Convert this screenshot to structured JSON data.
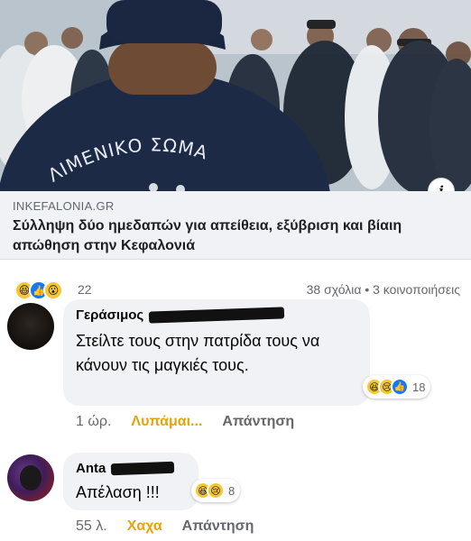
{
  "link_preview": {
    "image_text": "ΛΙΜΕΝΙΚΟ ΣΩΜΑ",
    "domain": "INKEFALONIA.GR",
    "title": "Σύλληψη δύο ημεδαπών για απείθεια, εξύβριση και βίαιη απώθηση στην Κεφαλονιά",
    "info_icon": "i"
  },
  "post_stats": {
    "reactions": [
      "haha-icon",
      "like-icon",
      "wow-icon"
    ],
    "reaction_count": "22",
    "comments_shares": "38 σχόλια • 3 κοινοποιήσεις"
  },
  "comments": [
    {
      "author": "Γεράσιμος",
      "text": "Στείλτε τους στην πατρίδα τους να κάνουν τις μαγκιές τους.",
      "reactions": [
        "haha-icon",
        "sad-icon",
        "like-icon"
      ],
      "reaction_count": "18",
      "time": "1 ώρ.",
      "reaction_label": "Λυπάμαι...",
      "reply": "Απάντηση"
    },
    {
      "author": "Anta",
      "text": "Απέλαση !!!",
      "reactions": [
        "haha-icon",
        "sad-icon"
      ],
      "reaction_count": "8",
      "time": "55 λ.",
      "reaction_label": "Χαχα",
      "reply": "Απάντηση"
    }
  ],
  "colors": {
    "reaction_label": "#e8a30c",
    "like_blue": "#1877f2",
    "bubble": "#f0f2f5"
  }
}
